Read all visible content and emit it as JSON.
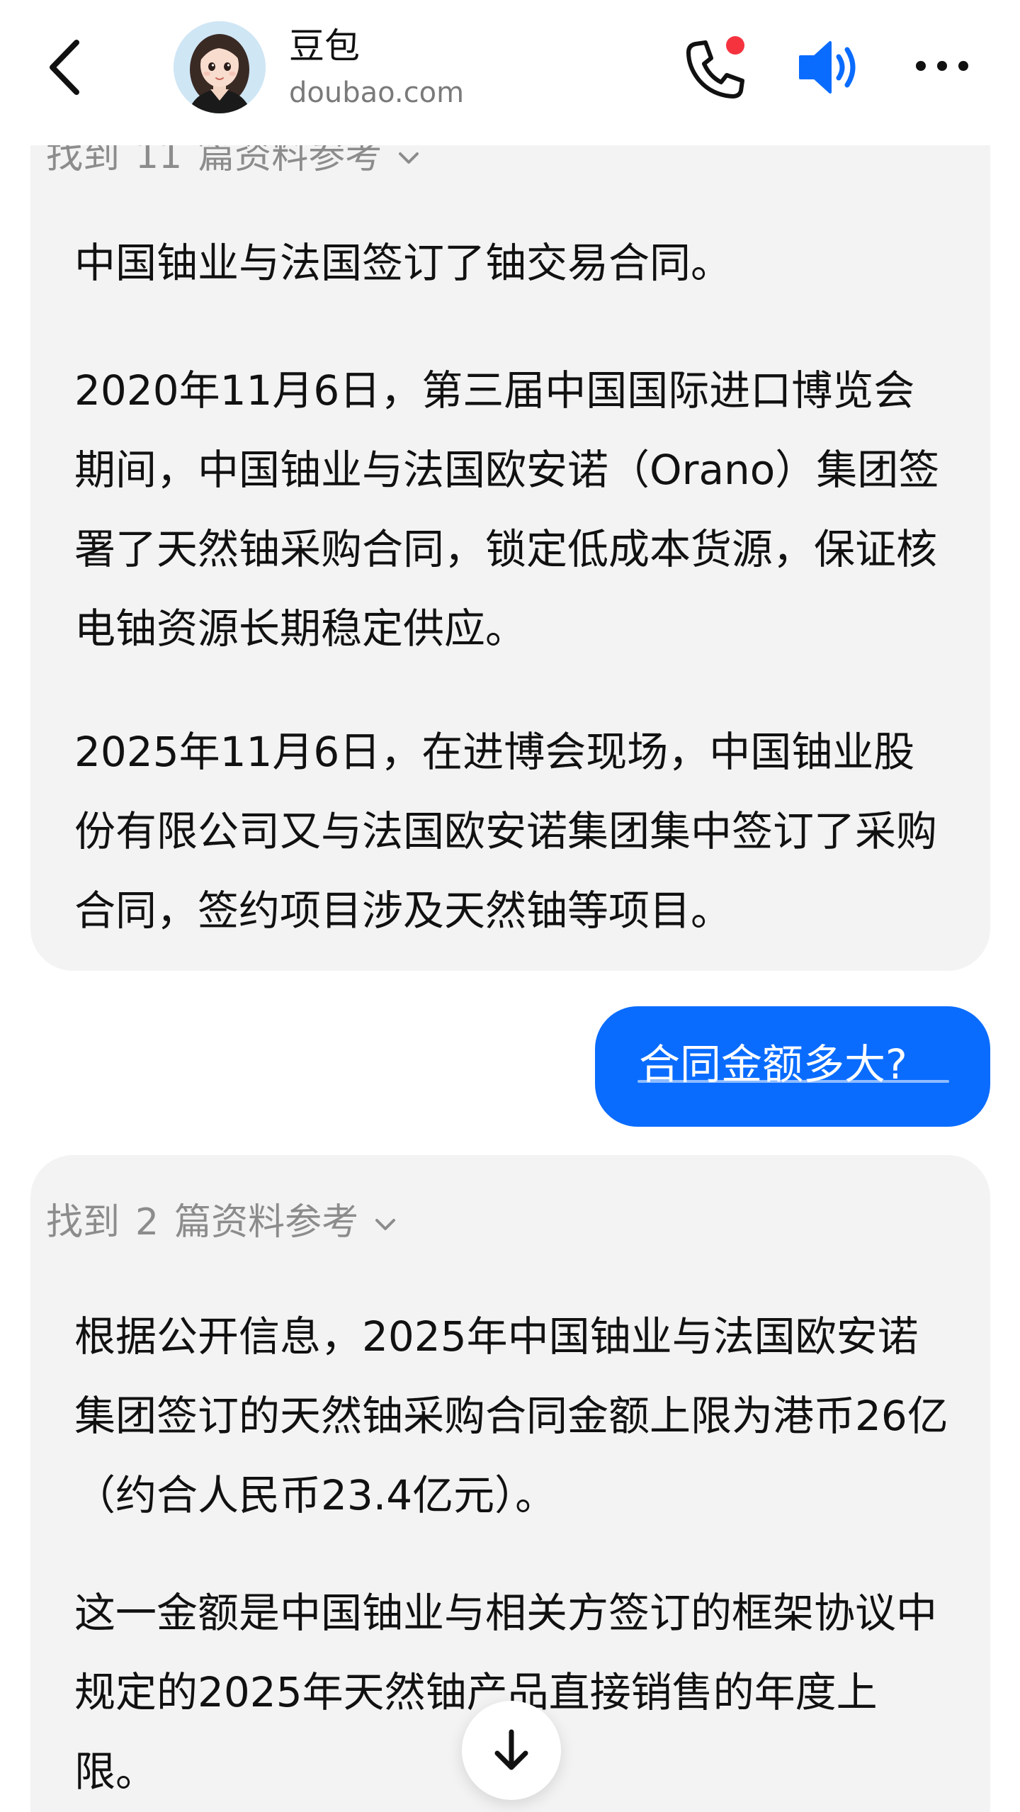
{
  "header": {
    "back_icon": "chevron-left-icon",
    "title": "豆包",
    "subtitle": "doubao.com",
    "phone_icon": "phone-icon",
    "phone_badge_color": "#f5333f",
    "speaker_icon": "speaker-icon",
    "speaker_color": "#0a6cff",
    "more_icon": "more-icon"
  },
  "messages": {
    "first_ai": {
      "refs_prefix": "找到",
      "refs_count": "11",
      "refs_suffix": "篇资料参考",
      "paragraphs": [
        "中国铀业与法国签订了铀交易合同。",
        "2020年11月6日，第三届中国国际进口博览会期间，中国铀业与法国欧安诺（Orano）集团签署了天然铀采购合同，锁定低成本货源，保证核电铀资源长期稳定供应。",
        "2025年11月6日，在进博会现场，中国铀业股份有限公司又与法国欧安诺集团集中签订了采购合同，签约项目涉及天然铀等项目。"
      ]
    },
    "user": {
      "text": "合同金额多大?"
    },
    "second_ai": {
      "refs_prefix": "找到",
      "refs_count": "2",
      "refs_suffix": "篇资料参考",
      "paragraphs": [
        "根据公开信息，2025年中国铀业与法国欧安诺集团签订的天然铀采购合同金额上限为港币26亿（约合人民币23.4亿元）。",
        "这一金额是中国铀业与相关方签订的框架协议中规定的2025年天然铀产品直接销售的年度上限。"
      ]
    }
  },
  "scroll_down_icon": "arrow-down-icon",
  "colors": {
    "accent": "#0a6cff",
    "ai_bubble": "#f3f3f3",
    "muted_text": "#8c8c8c"
  }
}
